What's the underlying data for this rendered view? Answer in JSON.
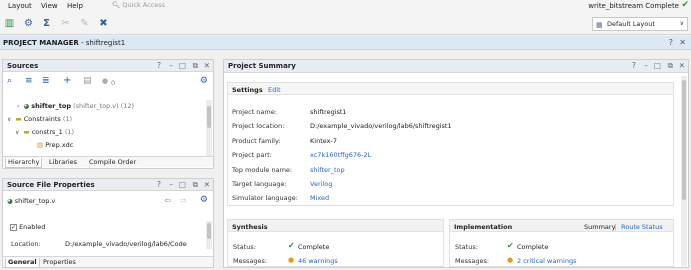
{
  "menu": {
    "layout": "Layout",
    "view": "View",
    "help": "Help"
  },
  "quick_access": {
    "placeholder": "Quick Access"
  },
  "status": {
    "text": "write_bitstream Complete"
  },
  "layout_select": {
    "value": "Default Layout"
  },
  "project_manager": {
    "title": "PROJECT MANAGER",
    "project": " - shiftregist1"
  },
  "sources": {
    "title": "Sources",
    "count": "0",
    "tree": [
      {
        "name": "shifter_top",
        "detail": " (shifter_top.v) (12)"
      },
      {
        "name": "Constraints",
        "detail": " (1)"
      },
      {
        "name": "constrs_1",
        "detail": " (1)"
      },
      {
        "name": "Prep.xdc",
        "detail": ""
      }
    ],
    "tabs": [
      "Hierarchy",
      "Libraries",
      "Compile Order"
    ]
  },
  "file_props": {
    "title": "Source File Properties",
    "file": "shifter_top.v",
    "enabled_label": "Enabled",
    "location_label": "Location:",
    "location_value": "D:/example_vivado/verilog/lab6/Code",
    "tabs": [
      "General",
      "Properties"
    ]
  },
  "summary": {
    "title": "Project Summary",
    "settings_label": "Settings",
    "edit_label": "Edit",
    "rows": [
      {
        "label": "Project name:",
        "value": "shiftregist1"
      },
      {
        "label": "Project location:",
        "value": "D:/example_vivado/verilog/lab6/shiftregist1"
      },
      {
        "label": "Product family:",
        "value": "Kintex-7"
      },
      {
        "label": "Project part:",
        "value": "xc7k160tffg676-2L"
      },
      {
        "label": "Top module name:",
        "value": "shifter_top"
      },
      {
        "label": "Target language:",
        "value": "Verilog"
      },
      {
        "label": "Simulator language:",
        "value": "Mixed"
      }
    ],
    "synthesis": {
      "title": "Synthesis",
      "status_label": "Status:",
      "status_value": "Complete",
      "messages_label": "Messages:",
      "messages_value": "46 warnings"
    },
    "implementation": {
      "title": "Implementation",
      "summary_link": "Summary",
      "separator": "|",
      "route_status": "Route Status",
      "status_label": "Status:",
      "status_value": "Complete",
      "messages_label": "Messages:",
      "messages_value": "2 critical warnings"
    }
  },
  "colors": {
    "accent": "#2a64c0",
    "ok": "#2e9a3a",
    "warn": "#e0a020",
    "header": "#dde8f5"
  }
}
